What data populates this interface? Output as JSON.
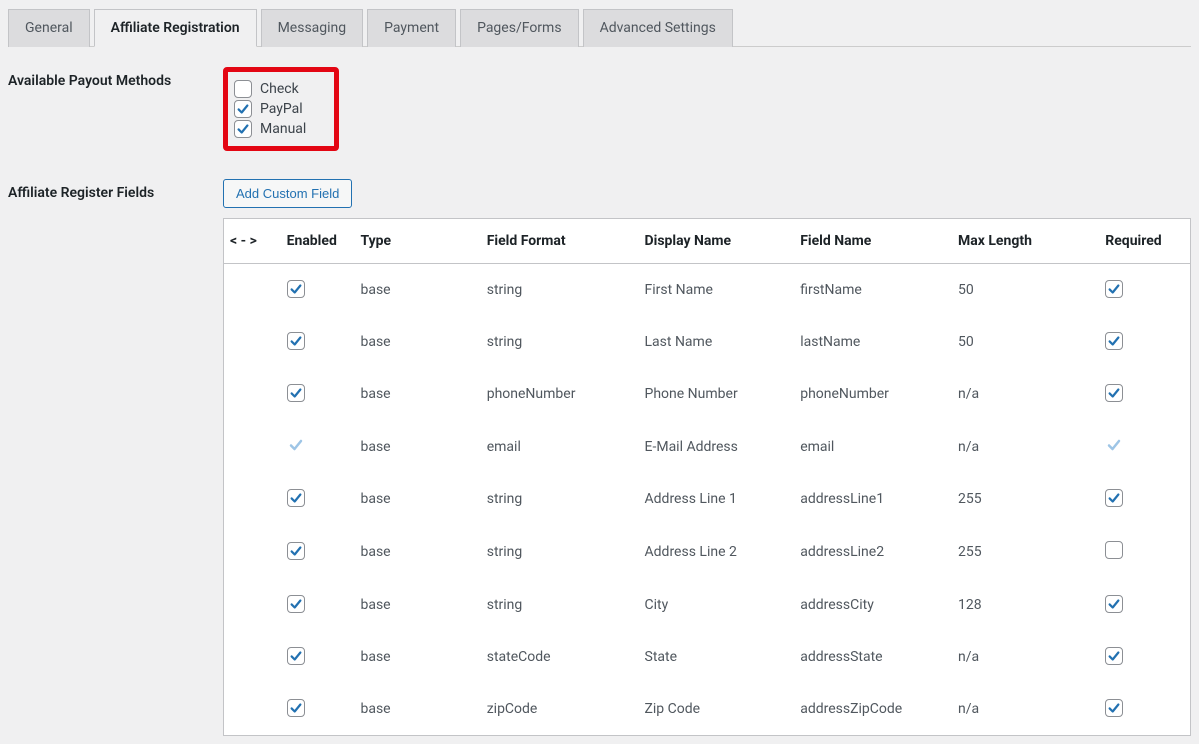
{
  "tabs": [
    {
      "label": "General",
      "active": false
    },
    {
      "label": "Affiliate Registration",
      "active": true
    },
    {
      "label": "Messaging",
      "active": false
    },
    {
      "label": "Payment",
      "active": false
    },
    {
      "label": "Pages/Forms",
      "active": false
    },
    {
      "label": "Advanced Settings",
      "active": false
    }
  ],
  "labels": {
    "payoutMethods": "Available Payout Methods",
    "registerFields": "Affiliate Register Fields",
    "addCustomField": "Add Custom Field"
  },
  "payoutMethods": [
    {
      "label": "Check",
      "checked": false
    },
    {
      "label": "PayPal",
      "checked": true
    },
    {
      "label": "Manual",
      "checked": true
    }
  ],
  "tableHeaders": {
    "reorder": "< - >",
    "enabled": "Enabled",
    "type": "Type",
    "format": "Field Format",
    "display": "Display Name",
    "field": "Field Name",
    "max": "Max Length",
    "required": "Required"
  },
  "fields": [
    {
      "enabled": true,
      "enabledLocked": false,
      "type": "base",
      "format": "string",
      "display": "First Name",
      "field": "firstName",
      "max": "50",
      "required": true,
      "requiredLocked": false
    },
    {
      "enabled": true,
      "enabledLocked": false,
      "type": "base",
      "format": "string",
      "display": "Last Name",
      "field": "lastName",
      "max": "50",
      "required": true,
      "requiredLocked": false
    },
    {
      "enabled": true,
      "enabledLocked": false,
      "type": "base",
      "format": "phoneNumber",
      "display": "Phone Number",
      "field": "phoneNumber",
      "max": "n/a",
      "required": true,
      "requiredLocked": false
    },
    {
      "enabled": true,
      "enabledLocked": true,
      "type": "base",
      "format": "email",
      "display": "E-Mail Address",
      "field": "email",
      "max": "n/a",
      "required": true,
      "requiredLocked": true
    },
    {
      "enabled": true,
      "enabledLocked": false,
      "type": "base",
      "format": "string",
      "display": "Address Line 1",
      "field": "addressLine1",
      "max": "255",
      "required": true,
      "requiredLocked": false
    },
    {
      "enabled": true,
      "enabledLocked": false,
      "type": "base",
      "format": "string",
      "display": "Address Line 2",
      "field": "addressLine2",
      "max": "255",
      "required": false,
      "requiredLocked": false
    },
    {
      "enabled": true,
      "enabledLocked": false,
      "type": "base",
      "format": "string",
      "display": "City",
      "field": "addressCity",
      "max": "128",
      "required": true,
      "requiredLocked": false
    },
    {
      "enabled": true,
      "enabledLocked": false,
      "type": "base",
      "format": "stateCode",
      "display": "State",
      "field": "addressState",
      "max": "n/a",
      "required": true,
      "requiredLocked": false
    },
    {
      "enabled": true,
      "enabledLocked": false,
      "type": "base",
      "format": "zipCode",
      "display": "Zip Code",
      "field": "addressZipCode",
      "max": "n/a",
      "required": true,
      "requiredLocked": false
    }
  ]
}
